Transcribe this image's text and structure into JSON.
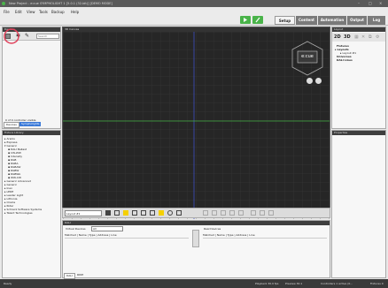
{
  "window": {
    "title": "New Project - e:cue SYMPHOLIGHT 1 [5.0.1 (32-bit)] [DEMO MODE]"
  },
  "window_controls": {
    "minimize": "–",
    "maximize": "□",
    "close": "×"
  },
  "menu": [
    "File",
    "Edit",
    "View",
    "Tools",
    "Backup",
    "Help"
  ],
  "modes": [
    "Setup",
    "Content",
    "Automation",
    "Output",
    "Log"
  ],
  "active_mode": "Setup",
  "left_panel": {
    "title": "Devices",
    "search_placeholder": "Search",
    "count_text": "0 of 0 controller visible",
    "tabs": [
      "Devices",
      "Sympholights"
    ]
  },
  "fixture_library": {
    "title": "Fixture Library",
    "items": [
      "Arenis",
      "Expresa",
      "Generic",
      "DALI Ballast",
      "CW-WW",
      "Intensity",
      "RGB",
      "RGBA",
      "RGBAW",
      "RGBW",
      "RGBWA",
      "WW-CW",
      "Generic Advanced",
      "Generic",
      "Ineo",
      "LEDE",
      "Leader Light",
      "Lithonia",
      "Oracle",
      "Rider",
      "Schreck Software Systems",
      "Talent Technologies"
    ]
  },
  "canvas": {
    "title": "3D Canvas",
    "cube_label": "e:cue",
    "layout_select": "Layout #1"
  },
  "dali": {
    "title": "DALI",
    "virtual_devices_label": "Virtual Devices",
    "virtual_filter": "All",
    "real_devices_label": "Real Devices",
    "columns": [
      "Matched",
      "Name",
      "Type",
      "Address",
      "Line"
    ],
    "tabs": [
      "DALI",
      "RDM"
    ]
  },
  "layout_panel": {
    "title": "Layout",
    "mode_2d": "2D",
    "mode_3d": "3D",
    "tree": [
      "Fixtures",
      "Layouts",
      "Layout #1",
      "Universes",
      "DALI Lines"
    ]
  },
  "properties_panel": {
    "title": "Properties"
  },
  "statusbar": {
    "left": "Ready",
    "playback": "Playback 30.0 fps",
    "preview": "Preview 30.1",
    "controllers": "Controllers 1 active (0...",
    "fixtures": "Fixtures 0"
  },
  "colors": {
    "accent_green": "#49b349",
    "title_bg": "#5a5a5a",
    "panel_header": "#3e3e3e",
    "highlight_circle": "#e0405a"
  }
}
